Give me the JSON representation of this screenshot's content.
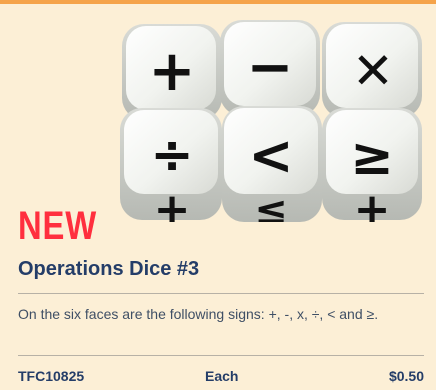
{
  "badge": "NEW",
  "product": {
    "title": "Operations Dice #3",
    "description": "On the six faces are the following signs: +, -, x, ÷, < and ≥.",
    "sku": "TFC10825",
    "unit": "Each",
    "price": "$0.50"
  },
  "image": {
    "name": "operations-dice-photo",
    "symbols": [
      "+",
      "−",
      "✕",
      "÷",
      "<",
      "≥",
      "+",
      "≤",
      "+"
    ]
  },
  "colors": {
    "background": "#fcefd6",
    "accent_orange": "#f5a34a",
    "badge_red": "#ff2f3e",
    "title_navy": "#243d68",
    "text_gray": "#3f4f65"
  }
}
